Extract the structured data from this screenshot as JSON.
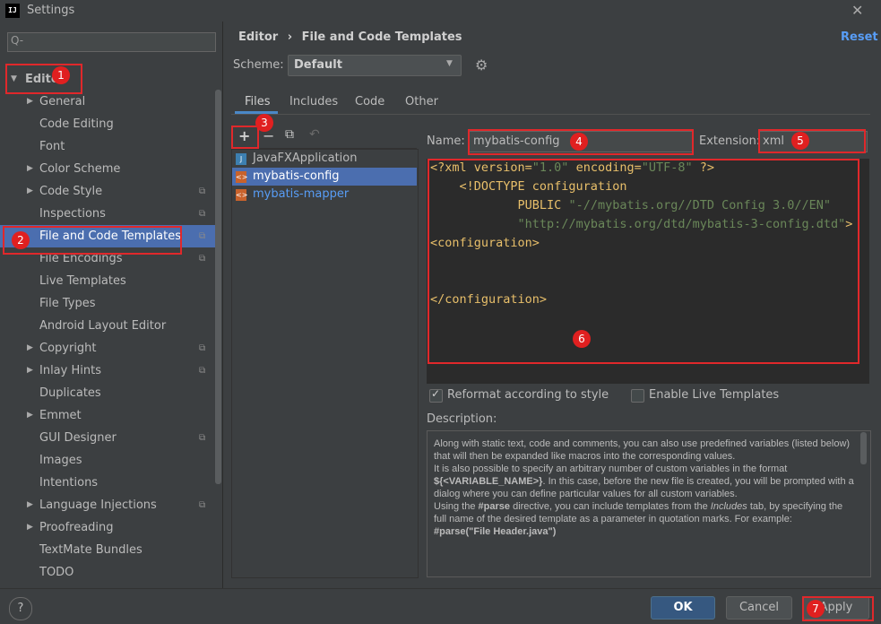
{
  "window": {
    "title": "Settings",
    "logo": "IJ"
  },
  "search": {
    "placeholder": "Q-"
  },
  "sidebar": {
    "root": "Editor",
    "items": [
      {
        "label": "General",
        "arrow": true,
        "proj": false
      },
      {
        "label": "Code Editing",
        "arrow": false,
        "proj": false
      },
      {
        "label": "Font",
        "arrow": false,
        "proj": false
      },
      {
        "label": "Color Scheme",
        "arrow": true,
        "proj": false
      },
      {
        "label": "Code Style",
        "arrow": true,
        "proj": true
      },
      {
        "label": "Inspections",
        "arrow": false,
        "proj": true
      },
      {
        "label": "File and Code Templates",
        "arrow": false,
        "proj": true,
        "selected": true
      },
      {
        "label": "File Encodings",
        "arrow": false,
        "proj": true
      },
      {
        "label": "Live Templates",
        "arrow": false,
        "proj": false
      },
      {
        "label": "File Types",
        "arrow": false,
        "proj": false
      },
      {
        "label": "Android Layout Editor",
        "arrow": false,
        "proj": false
      },
      {
        "label": "Copyright",
        "arrow": true,
        "proj": true
      },
      {
        "label": "Inlay Hints",
        "arrow": true,
        "proj": true
      },
      {
        "label": "Duplicates",
        "arrow": false,
        "proj": false
      },
      {
        "label": "Emmet",
        "arrow": true,
        "proj": false
      },
      {
        "label": "GUI Designer",
        "arrow": false,
        "proj": true
      },
      {
        "label": "Images",
        "arrow": false,
        "proj": false
      },
      {
        "label": "Intentions",
        "arrow": false,
        "proj": false
      },
      {
        "label": "Language Injections",
        "arrow": true,
        "proj": true
      },
      {
        "label": "Proofreading",
        "arrow": true,
        "proj": false
      },
      {
        "label": "TextMate Bundles",
        "arrow": false,
        "proj": false
      },
      {
        "label": "TODO",
        "arrow": false,
        "proj": false
      }
    ]
  },
  "header": {
    "breadcrumb_parent": "Editor",
    "breadcrumb_sep": "›",
    "breadcrumb_current": "File and Code Templates",
    "reset": "Reset"
  },
  "scheme": {
    "label": "Scheme:",
    "value": "Default"
  },
  "tabs": [
    "Files",
    "Includes",
    "Code",
    "Other"
  ],
  "templates": [
    {
      "name": "JavaFXApplication",
      "type": "java"
    },
    {
      "name": "mybatis-config",
      "type": "xml",
      "selected": true
    },
    {
      "name": "mybatis-mapper",
      "type": "xml",
      "link": true
    }
  ],
  "form": {
    "name_label": "Name:",
    "name_value": "mybatis-config",
    "ext_label": "Extension:",
    "ext_value": "xml"
  },
  "code": {
    "l1_a": "<?xml version=",
    "l1_b": "\"1.0\"",
    "l1_c": " encoding=",
    "l1_d": "\"UTF-8\"",
    "l1_e": " ?>",
    "l2": "    <!DOCTYPE configuration",
    "l3_a": "            PUBLIC ",
    "l3_b": "\"-//mybatis.org//DTD Config 3.0//EN\"",
    "l4_a": "            ",
    "l4_b": "\"http://mybatis.org/dtd/mybatis-3-config.dtd\"",
    "l4_c": ">",
    "l5": "<configuration>",
    "l6": "</configuration>"
  },
  "options": {
    "reformat": "Reformat according to style",
    "live": "Enable Live Templates"
  },
  "description": {
    "label": "Description:",
    "p1": "Along with static text, code and comments, you can also use predefined variables (listed below) that will then be expanded like macros into the corresponding values.",
    "p2a": "It is also possible to specify an arbitrary number of custom variables in the format ",
    "p2b": "${<VARIABLE_NAME>}",
    "p2c": ". In this case, before the new file is created, you will be prompted with a dialog where you can define particular values for all custom variables.",
    "p3a": "Using the ",
    "p3b": "#parse",
    "p3c": " directive, you can include templates from the ",
    "p3d": "Includes",
    "p3e": " tab, by specifying the full name of the desired template as a parameter in quotation marks. For example:",
    "p4": "#parse(\"File Header.java\")"
  },
  "footer": {
    "help": "?",
    "ok": "OK",
    "cancel": "Cancel",
    "apply": "Apply"
  },
  "badges": [
    "1",
    "2",
    "3",
    "4",
    "5",
    "6",
    "7"
  ]
}
